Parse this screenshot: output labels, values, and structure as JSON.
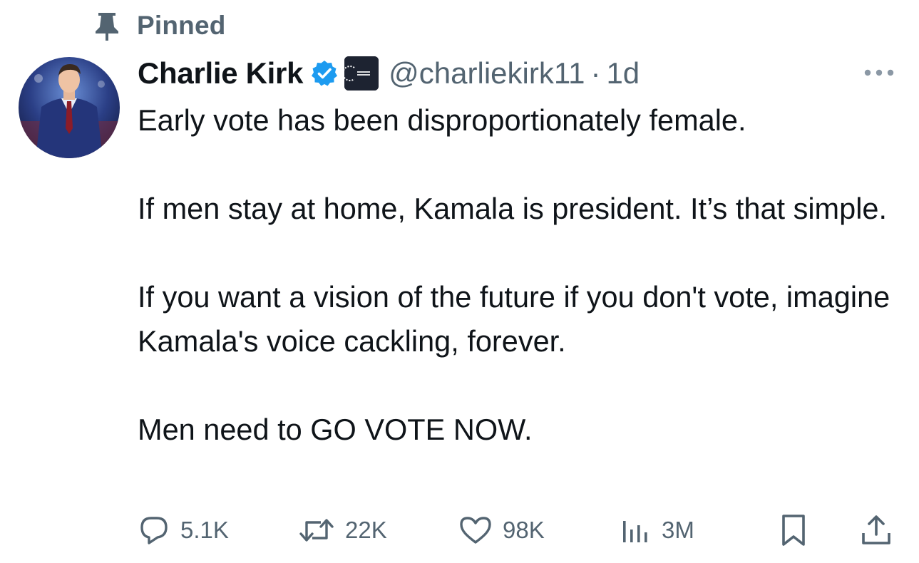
{
  "pinned": {
    "label": "Pinned",
    "icon": "pin-icon"
  },
  "author": {
    "display_name": "Charlie Kirk",
    "handle": "@charliekirk11",
    "separator": "·",
    "time": "1d",
    "verified_color": "#1d9bf0",
    "affiliate_badge": "turning-point-usa-logo",
    "avatar": "profile-photo"
  },
  "tweet": {
    "paragraphs": [
      "Early vote has been disproportionately female.",
      "If men stay at home, Kamala is president. It’s that simple.",
      "If you want a vision of the future if you don't vote, imagine Kamala's voice cackling, forever.",
      "Men need to GO VOTE NOW."
    ]
  },
  "actions": {
    "replies": {
      "icon": "reply-icon",
      "count": "5.1K"
    },
    "reposts": {
      "icon": "repost-icon",
      "count": "22K"
    },
    "likes": {
      "icon": "heart-icon",
      "count": "98K"
    },
    "views": {
      "icon": "analytics-icon",
      "count": "3M"
    },
    "bookmark": {
      "icon": "bookmark-icon"
    },
    "share": {
      "icon": "share-icon"
    }
  },
  "colors": {
    "text_primary": "#0f1419",
    "text_secondary": "#536471",
    "accent": "#1d9bf0"
  }
}
